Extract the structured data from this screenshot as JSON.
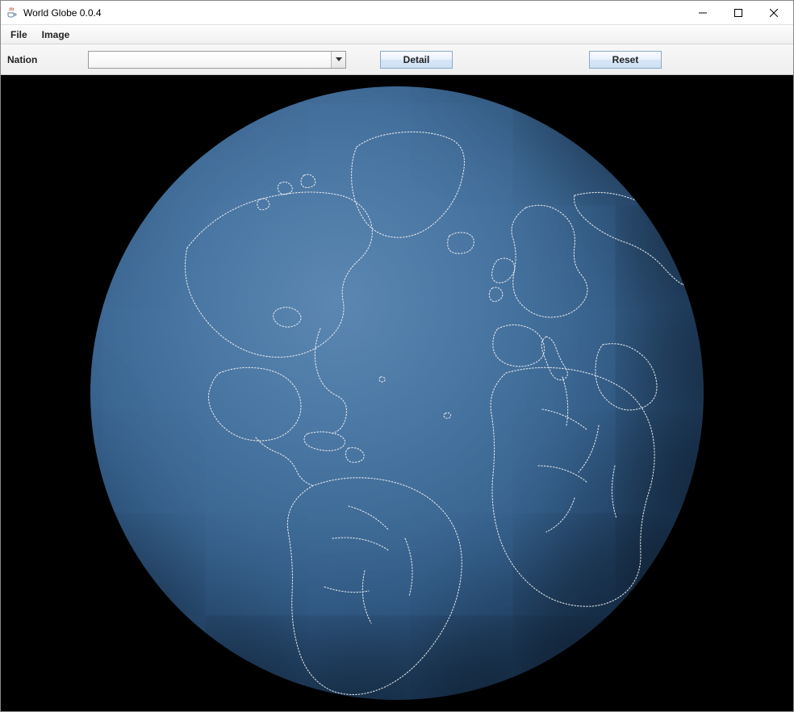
{
  "window": {
    "title": "World Globe 0.0.4",
    "icon": "java-cup-icon"
  },
  "menubar": {
    "items": [
      {
        "label": "File"
      },
      {
        "label": "Image"
      }
    ]
  },
  "toolbar": {
    "nation_label": "Nation",
    "nation_selected": "",
    "detail_label": "Detail",
    "reset_label": "Reset"
  },
  "globe": {
    "fill_color": "#3c6894",
    "coastline_color": "#f0f0f0",
    "background_color": "#000000"
  }
}
